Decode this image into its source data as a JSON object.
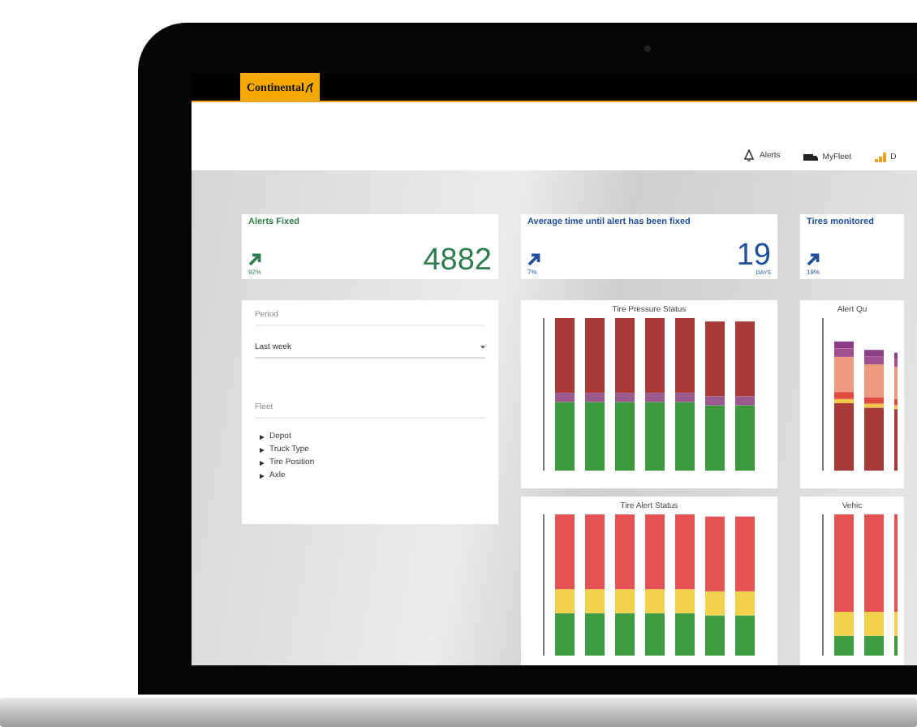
{
  "logo": {
    "text": "Continental"
  },
  "nav": [
    {
      "label": "Alerts"
    },
    {
      "label": "MyFleet"
    },
    {
      "label": "D"
    }
  ],
  "kpis": [
    {
      "title": "Alerts Fixed",
      "value": "4882",
      "change": "92%",
      "color": "#2e7d4f"
    },
    {
      "title": "Average time until alert has been fixed",
      "value": "19",
      "unit": "DAYS",
      "change": "7%",
      "color": "#1f4e9c"
    },
    {
      "title": "Tires monitored",
      "change": "19%",
      "color": "#1f4e9c"
    }
  ],
  "filters": {
    "period_label": "Period",
    "period_value": "Last week",
    "fleet_label": "Fleet",
    "fleet_items": [
      "Depot",
      "Truck Type",
      "Tire Position",
      "Axle"
    ]
  },
  "charts": [
    {
      "title": "Tire Pressure Status",
      "kind": "pressure"
    },
    {
      "title": "Alert Qu",
      "kind": "alert-quality"
    },
    {
      "title": "Tire Alert Status",
      "kind": "alert-status"
    },
    {
      "title": "Vehic",
      "kind": "vehicle"
    }
  ]
}
